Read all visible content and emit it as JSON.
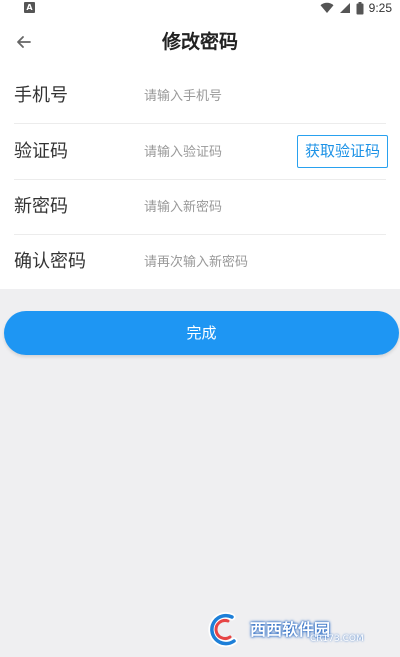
{
  "status_bar": {
    "time": "9:25"
  },
  "header": {
    "title": "修改密码"
  },
  "form": {
    "phone": {
      "label": "手机号",
      "placeholder": "请输入手机号",
      "value": ""
    },
    "code": {
      "label": "验证码",
      "placeholder": "请输入验证码",
      "value": "",
      "button_label": "获取验证码"
    },
    "new_password": {
      "label": "新密码",
      "placeholder": "请输入新密码",
      "value": ""
    },
    "confirm_password": {
      "label": "确认密码",
      "placeholder": "请再次输入新密码",
      "value": ""
    }
  },
  "submit": {
    "label": "完成"
  },
  "watermark": {
    "brand": "西西软件园",
    "url": "CR173.COM"
  },
  "colors": {
    "accent": "#1e96f3",
    "background": "#efeff1"
  }
}
